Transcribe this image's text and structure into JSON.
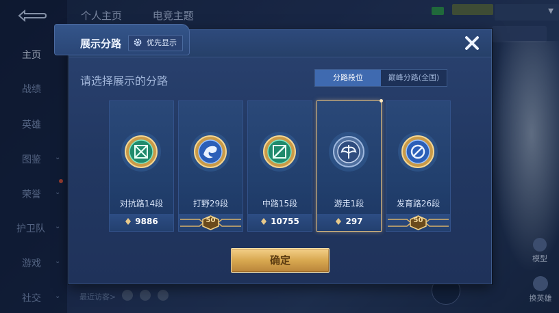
{
  "background": {
    "sidebar_items": [
      {
        "label": "主页",
        "active": true,
        "chevron": false
      },
      {
        "label": "战绩",
        "active": false,
        "chevron": false
      },
      {
        "label": "英雄",
        "active": false,
        "chevron": false
      },
      {
        "label": "图鉴",
        "active": false,
        "chevron": true
      },
      {
        "label": "荣誉",
        "active": false,
        "chevron": true
      },
      {
        "label": "护卫队",
        "active": false,
        "chevron": true
      },
      {
        "label": "游戏",
        "active": false,
        "chevron": true
      },
      {
        "label": "社交",
        "active": false,
        "chevron": true
      }
    ],
    "top_tabs": [
      "个人主页",
      "电竞主题"
    ],
    "model_label": "模型",
    "swap_hero_label": "换英雄",
    "recent_visitors_label": "最近访客>"
  },
  "dialog": {
    "title": "展示分路",
    "priority_button": "优先显示",
    "subtitle": "请选择展示的分路",
    "segments": [
      {
        "label": "分路段位",
        "active": true
      },
      {
        "label": "巅峰分路(全国)",
        "active": false
      }
    ],
    "cards": [
      {
        "label": "对抗路14段",
        "score": "9886",
        "score_type": "points",
        "icon": "clash-lane-icon",
        "selected": false
      },
      {
        "label": "打野29段",
        "score": "50",
        "score_type": "medal",
        "icon": "jungle-dragon-icon",
        "selected": false
      },
      {
        "label": "中路15段",
        "score": "10755",
        "score_type": "points",
        "icon": "mid-lane-icon",
        "selected": false
      },
      {
        "label": "游走1段",
        "score": "297",
        "score_type": "points",
        "icon": "roam-wings-icon",
        "selected": true
      },
      {
        "label": "发育路26段",
        "score": "50",
        "score_type": "medal",
        "icon": "farm-lane-icon",
        "selected": false
      }
    ],
    "confirm_label": "确定"
  },
  "colors": {
    "accent_blue": "#3f6ab0",
    "gold": "#d8a850",
    "selected_border": "#d8b880"
  }
}
